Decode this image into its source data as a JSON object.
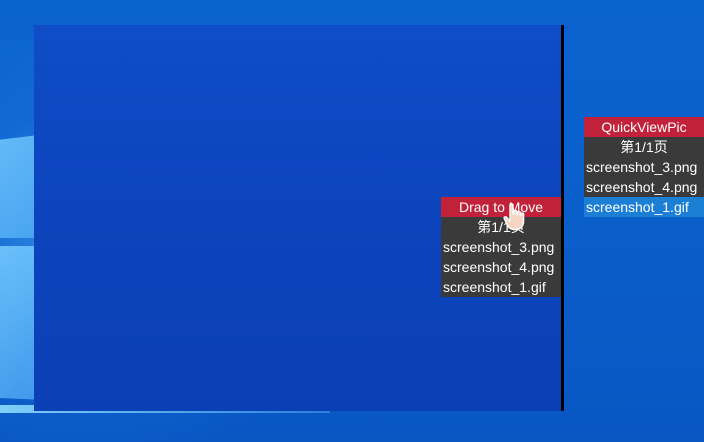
{
  "drag_panel": {
    "header": "Drag to Move",
    "page_label": "第1/1页",
    "items": [
      {
        "label": "screenshot_3.png"
      },
      {
        "label": "screenshot_4.png"
      },
      {
        "label": "screenshot_1.gif"
      }
    ]
  },
  "quick_panel": {
    "header": "QuickViewPic",
    "page_label": "第1/1页",
    "items": [
      {
        "label": "screenshot_3.png"
      },
      {
        "label": "screenshot_4.png"
      },
      {
        "label": "screenshot_1.gif",
        "selected": true
      }
    ]
  },
  "colors": {
    "header": "#c1223a",
    "row": "#3a3a3a",
    "selected": "#1c7fd6",
    "preview": "#0c44bd"
  },
  "icons": {
    "cursor": "hand-pointer-icon"
  }
}
